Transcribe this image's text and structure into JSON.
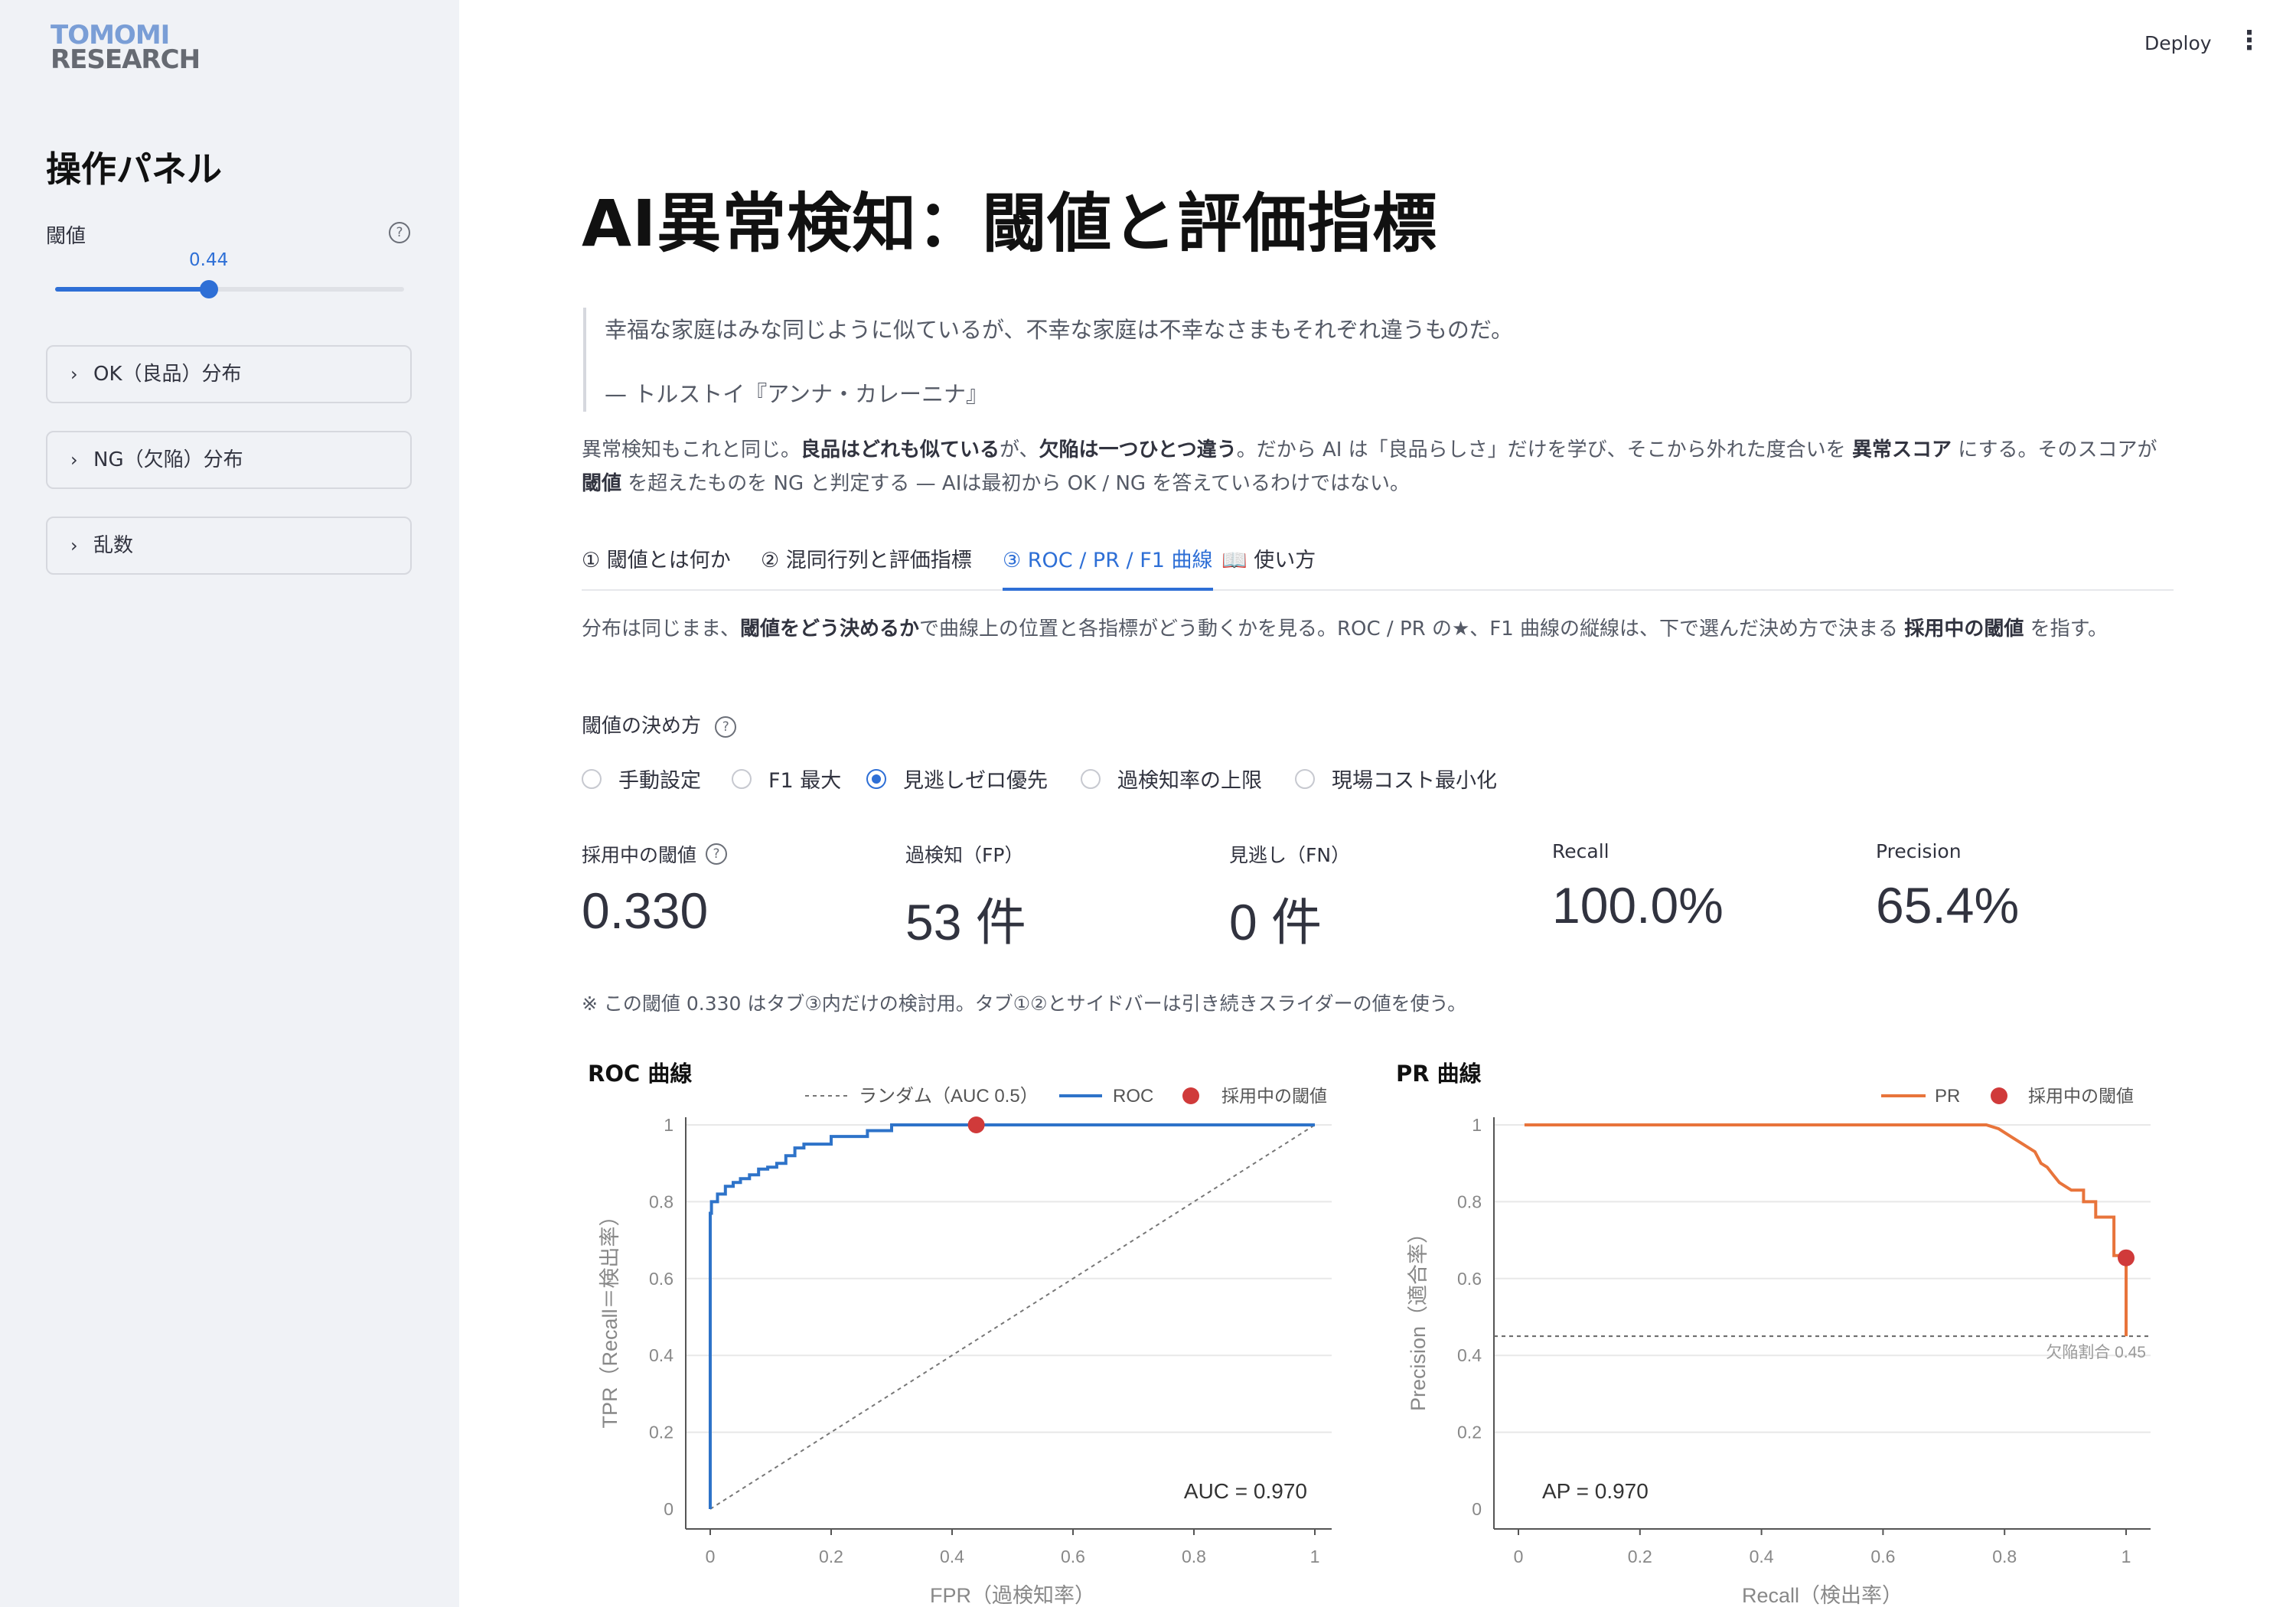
{
  "sidebar": {
    "logo_line1": "TOMOMI",
    "logo_line2": "RESEARCH",
    "title": "操作パネル",
    "slider": {
      "label": "閾値",
      "value": 0.44,
      "value_text": "0.44",
      "min": 0,
      "max": 1
    },
    "expanders": [
      {
        "label": "OK（良品）分布"
      },
      {
        "label": "NG（欠陥）分布"
      },
      {
        "label": "乱数"
      }
    ]
  },
  "header": {
    "deploy_label": "Deploy",
    "menu_icon": "kebab-menu-icon"
  },
  "main": {
    "title": "AI異常検知：閾値と評価指標",
    "quote": "幸福な家庭はみな同じように似ているが、不幸な家庭は不幸なさまもそれぞれ違うものだ。",
    "quote_source": "— トルストイ『アンナ・カレーニナ』",
    "intro": {
      "p1": "異常検知もこれと同じ。",
      "b1": "良品はどれも似ている",
      "p2": "が、",
      "b2": "欠陥は一つひとつ違う",
      "p3": "。だから AI は「良品らしさ」だけを学び、そこから外れた度合いを ",
      "b3": "異常スコア",
      "p4": " にする。そのスコアが ",
      "b4": "閾値",
      "p5": " を超えたものを NG と判定する — AIは最初から OK / NG を答えているわけではない。"
    },
    "tabs": [
      {
        "label": "① 閾値とは何か"
      },
      {
        "label": "② 混同行列と評価指標"
      },
      {
        "label": "③ ROC / PR / F1 曲線"
      },
      {
        "label": "📖 使い方"
      }
    ],
    "active_tab": 2,
    "tab_desc": {
      "p1": "分布は同じまま、",
      "b1": "閾値をどう決めるか",
      "p2": "で曲線上の位置と各指標がどう動くかを見る。ROC / PR の★、F1 曲線の縦線は、下で選んだ決め方で決まる ",
      "b2": "採用中の閾値",
      "p3": " を指す。"
    },
    "radio": {
      "title": "閾値の決め方",
      "options": [
        "手動設定",
        "F1 最大",
        "見逃しゼロ優先",
        "過検知率の上限",
        "現場コスト最小化"
      ],
      "selected": 2
    },
    "metrics": [
      {
        "label": "採用中の閾値",
        "value": "0.330",
        "help": true
      },
      {
        "label": "過検知（FP）",
        "value": "53 件"
      },
      {
        "label": "見逃し（FN）",
        "value": "0 件"
      },
      {
        "label": "Recall",
        "value": "100.0%"
      },
      {
        "label": "Precision",
        "value": "65.4%"
      }
    ],
    "note": "※ この閾値 0.330 はタブ③内だけの検討用。タブ①②とサイドバーは引き続きスライダーの値を使う。"
  },
  "chart_data": [
    {
      "type": "line",
      "title": "ROC 曲線",
      "xlabel": "FPR（過検知率）",
      "ylabel": "TPR（Recall＝検出率）",
      "xlim": [
        0,
        1
      ],
      "ylim": [
        0,
        1
      ],
      "xticks": [
        "0",
        "0.2",
        "0.4",
        "0.6",
        "0.8",
        "1"
      ],
      "yticks": [
        "0",
        "0.2",
        "0.4",
        "0.6",
        "0.8",
        "1"
      ],
      "legend": [
        "ランダム（AUC 0.5）",
        "ROC",
        "採用中の閾値"
      ],
      "legend_position": "top-right",
      "annotation": "AUC = 0.970",
      "colors": {
        "roc": "#2e73c9",
        "random": "#777777",
        "marker": "#d03a3a"
      },
      "series": [
        {
          "name": "ROC",
          "x": [
            0,
            0,
            0.002,
            0.002,
            0.012,
            0.012,
            0.025,
            0.025,
            0.038,
            0.038,
            0.05,
            0.05,
            0.065,
            0.065,
            0.08,
            0.08,
            0.095,
            0.095,
            0.11,
            0.11,
            0.125,
            0.125,
            0.14,
            0.14,
            0.155,
            0.155,
            0.2,
            0.2,
            0.26,
            0.26,
            0.3,
            0.3,
            0.44,
            1
          ],
          "y": [
            0,
            0.77,
            0.77,
            0.8,
            0.8,
            0.82,
            0.82,
            0.84,
            0.84,
            0.85,
            0.85,
            0.86,
            0.86,
            0.87,
            0.87,
            0.885,
            0.885,
            0.89,
            0.89,
            0.9,
            0.9,
            0.92,
            0.92,
            0.94,
            0.94,
            0.95,
            0.95,
            0.97,
            0.97,
            0.985,
            0.985,
            1,
            1,
            1
          ]
        },
        {
          "name": "ランダム（AUC 0.5）",
          "x": [
            0,
            1
          ],
          "y": [
            0,
            1
          ]
        }
      ],
      "marker": {
        "name": "採用中の閾値",
        "x": 0.44,
        "y": 1.0
      }
    },
    {
      "type": "line",
      "title": "PR 曲線",
      "xlabel": "Recall（検出率）",
      "ylabel": "Precision（適合率）",
      "xlim": [
        0,
        1
      ],
      "ylim": [
        0,
        1
      ],
      "xticks": [
        "0",
        "0.2",
        "0.4",
        "0.6",
        "0.8",
        "1"
      ],
      "yticks": [
        "0",
        "0.2",
        "0.4",
        "0.6",
        "0.8",
        "1"
      ],
      "legend": [
        "PR",
        "採用中の閾値"
      ],
      "legend_position": "top-right",
      "annotation": "AP = 0.970",
      "baseline_label": "欠陥割合 0.45",
      "baseline": 0.45,
      "colors": {
        "pr": "#e8743b",
        "baseline": "#666666",
        "marker": "#d03a3a"
      },
      "series": [
        {
          "name": "PR",
          "x": [
            0.01,
            0.77,
            0.79,
            0.81,
            0.83,
            0.85,
            0.86,
            0.87,
            0.88,
            0.89,
            0.9,
            0.91,
            0.93,
            0.93,
            0.95,
            0.95,
            0.98,
            0.98,
            1,
            1
          ],
          "y": [
            1,
            1,
            0.99,
            0.97,
            0.95,
            0.93,
            0.9,
            0.89,
            0.87,
            0.85,
            0.84,
            0.83,
            0.83,
            0.8,
            0.8,
            0.76,
            0.76,
            0.66,
            0.66,
            0.45
          ]
        }
      ],
      "marker": {
        "name": "採用中の閾値",
        "x": 1.0,
        "y": 0.654
      }
    }
  ]
}
